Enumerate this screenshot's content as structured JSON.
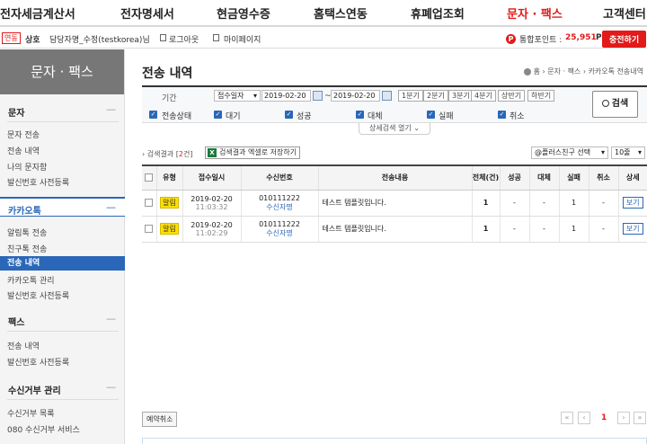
{
  "topnav": [
    "전자세금계산서",
    "전자명세서",
    "현금영수증",
    "홈택스연동",
    "휴폐업조회",
    "문자 · 팩스",
    "고객센터"
  ],
  "userbar": {
    "badge": "연동",
    "company_label": "상호",
    "user": "담당자명_수정(testkorea)님",
    "logout": "로그아웃",
    "mypage": "마이페이지",
    "point_icon": "P",
    "point_label": "통합포인트 :",
    "point_value": "25,951",
    "point_unit": "P",
    "charge": "충전하기"
  },
  "sidebar": {
    "title": "문자 · 팩스",
    "sections": [
      {
        "title": "문자",
        "toggle": "—",
        "items": [
          "문자 전송",
          "전송 내역",
          "나의 문자함",
          "발신번호 사전등록"
        ]
      },
      {
        "title": "카카오톡",
        "toggle": "—",
        "items": [
          "알림톡 전송",
          "친구톡 전송",
          "전송 내역",
          "카카오톡 관리",
          "발신번호 사전등록"
        ]
      },
      {
        "title": "팩스",
        "toggle": "—",
        "items": [
          "전송 내역",
          "발신번호 사전등록"
        ]
      },
      {
        "title": "수신거부 관리",
        "toggle": "—",
        "items": [
          "수신거부 목록",
          "080 수신거부 서비스"
        ]
      }
    ]
  },
  "page": {
    "title": "전송 내역",
    "breadcrumb": "홈 › 문자 · 팩스 › 카카오톡 전송내역"
  },
  "filter": {
    "period_label": "기간",
    "date_type": "접수일자",
    "date_from": "2019-02-20",
    "date_to": "2019-02-20",
    "tilde": "~",
    "quick": [
      "1분기",
      "2분기",
      "3분기",
      "4분기",
      "상반기",
      "하반기"
    ],
    "status_label": "전송상태",
    "statuses": [
      "대기",
      "성공",
      "대체",
      "실패",
      "취소"
    ],
    "search": "검색",
    "detail": "상세검색 열기"
  },
  "results": {
    "label_prefix": "검색결과 [",
    "count": "2",
    "label_suffix": "건]",
    "excel": "검색결과 엑셀로 저장하기",
    "friend_select": "@플러스친구 선택",
    "page_size": "10줄"
  },
  "table": {
    "headers": [
      "",
      "유형",
      "접수일시",
      "수신번호",
      "전송내용",
      "전체(건)",
      "성공",
      "대체",
      "실패",
      "취소",
      "상세"
    ],
    "rows": [
      {
        "type": "알림",
        "date": "2019-02-20",
        "time": "11:03:32",
        "number": "010111222",
        "receiver": "수신자명",
        "content": "테스트 템플릿입니다.",
        "total": "1",
        "success": "-",
        "alt": "-",
        "fail": "1",
        "cancel": "-",
        "detail": "보기"
      },
      {
        "type": "알림",
        "date": "2019-02-20",
        "time": "11:02:29",
        "number": "010111222",
        "receiver": "수신자명",
        "content": "테스트 템플릿입니다.",
        "total": "1",
        "success": "-",
        "alt": "-",
        "fail": "1",
        "cancel": "-",
        "detail": "보기"
      }
    ]
  },
  "bottom": {
    "cancel": "예약취소",
    "first": "«",
    "prev": "‹",
    "page": "1",
    "next": "›",
    "last": "»"
  }
}
